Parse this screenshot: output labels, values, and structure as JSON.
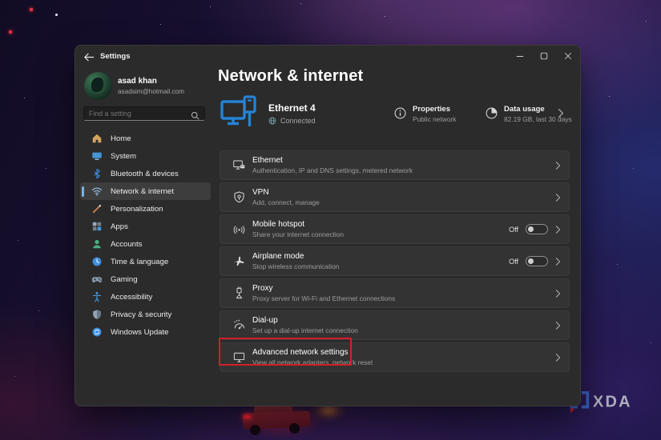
{
  "window": {
    "title": "Settings"
  },
  "user": {
    "name": "asad khan",
    "email": "asadsim@hotmail.com"
  },
  "search": {
    "placeholder": "Find a setting"
  },
  "sidebar": {
    "items": [
      {
        "label": "Home",
        "icon": "home",
        "selected": false
      },
      {
        "label": "System",
        "icon": "system",
        "selected": false
      },
      {
        "label": "Bluetooth & devices",
        "icon": "bluetooth",
        "selected": false
      },
      {
        "label": "Network & internet",
        "icon": "network",
        "selected": true
      },
      {
        "label": "Personalization",
        "icon": "personalization",
        "selected": false
      },
      {
        "label": "Apps",
        "icon": "apps",
        "selected": false
      },
      {
        "label": "Accounts",
        "icon": "accounts",
        "selected": false
      },
      {
        "label": "Time & language",
        "icon": "time",
        "selected": false
      },
      {
        "label": "Gaming",
        "icon": "gaming",
        "selected": false
      },
      {
        "label": "Accessibility",
        "icon": "accessibility",
        "selected": false
      },
      {
        "label": "Privacy & security",
        "icon": "privacy",
        "selected": false
      },
      {
        "label": "Windows Update",
        "icon": "update",
        "selected": false
      }
    ]
  },
  "page": {
    "title": "Network & internet",
    "hero": {
      "connection_name": "Ethernet 4",
      "connection_status": "Connected",
      "properties_title": "Properties",
      "properties_subtitle": "Public network",
      "data_usage_title": "Data usage",
      "data_usage_subtitle": "82.19 GB, last 30 days"
    },
    "rows": [
      {
        "title": "Ethernet",
        "subtitle": "Authentication, IP and DNS settings, metered network",
        "icon": "ethernet",
        "toggle": null,
        "highlighted": false
      },
      {
        "title": "VPN",
        "subtitle": "Add, connect, manage",
        "icon": "vpn",
        "toggle": null,
        "highlighted": false
      },
      {
        "title": "Mobile hotspot",
        "subtitle": "Share your internet connection",
        "icon": "hotspot",
        "toggle": "Off",
        "highlighted": false
      },
      {
        "title": "Airplane mode",
        "subtitle": "Stop wireless communication",
        "icon": "airplane",
        "toggle": "Off",
        "highlighted": false
      },
      {
        "title": "Proxy",
        "subtitle": "Proxy server for Wi-Fi and Ethernet connections",
        "icon": "proxy",
        "toggle": null,
        "highlighted": false
      },
      {
        "title": "Dial-up",
        "subtitle": "Set up a dial-up internet connection",
        "icon": "dialup",
        "toggle": null,
        "highlighted": false
      },
      {
        "title": "Advanced network settings",
        "subtitle": "View all network adapters, network reset",
        "icon": "advanced",
        "toggle": null,
        "highlighted": true
      }
    ]
  },
  "watermark": {
    "text": "XDA"
  },
  "colors": {
    "accent_blue": "#2583d6",
    "highlight_red": "#d21f28",
    "selected_pill": "#7ab5e0",
    "window_bg": "#2b2b2b",
    "row_bg": "#333333"
  }
}
